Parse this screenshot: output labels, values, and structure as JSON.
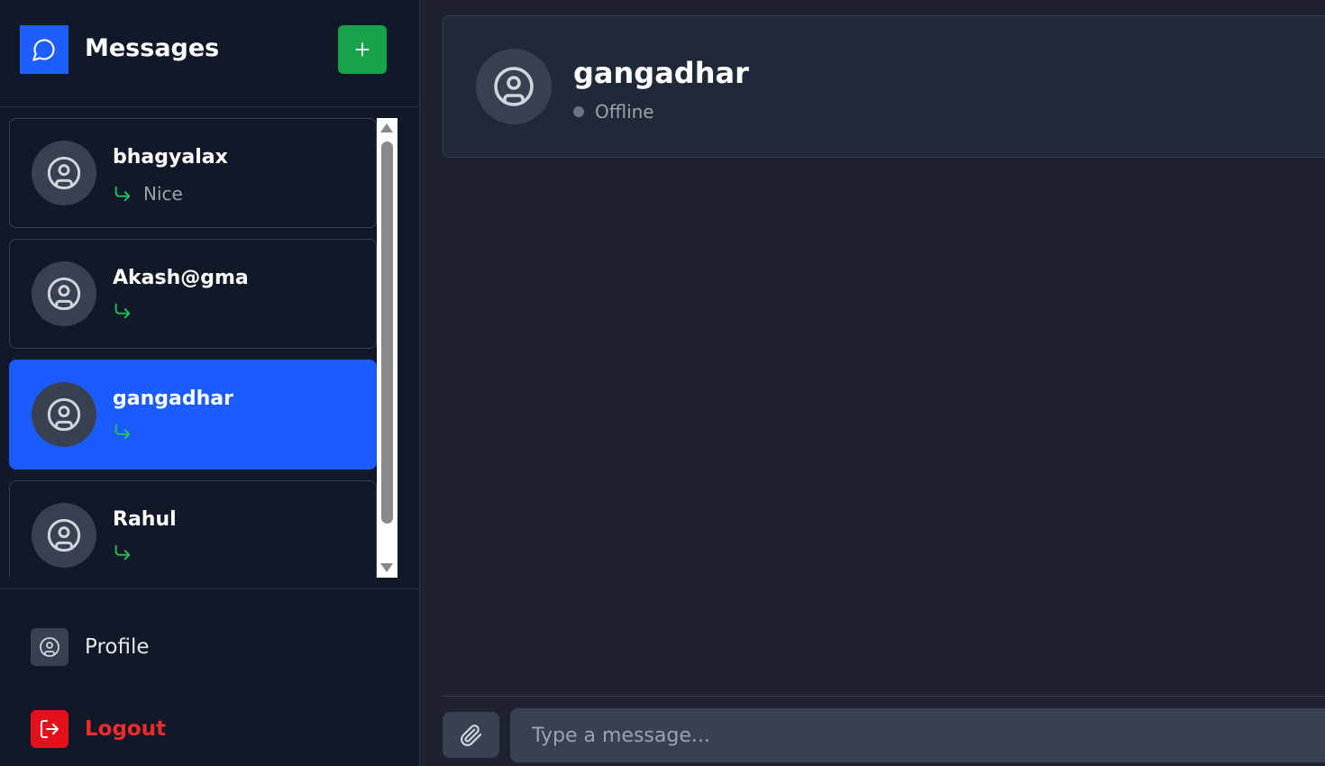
{
  "sidebar": {
    "title": "Messages",
    "new_button_icon": "plus-icon",
    "conversations": [
      {
        "name": "bhagyalax",
        "preview": "Nice",
        "active": false
      },
      {
        "name": "Akash@gma",
        "preview": "",
        "active": false
      },
      {
        "name": "gangadhar",
        "preview": "",
        "active": true
      },
      {
        "name": "Rahul",
        "preview": "",
        "active": false
      }
    ],
    "footer": {
      "profile_label": "Profile",
      "logout_label": "Logout"
    }
  },
  "chat": {
    "contact_name": "gangadhar",
    "status": "Offline"
  },
  "composer": {
    "placeholder": "Type a message..."
  },
  "colors": {
    "brand": "#1e5eff",
    "new_button": "#16a34a",
    "active_conversation": "#1a5cff",
    "reply_arrow": "#22c55e",
    "logout": "#e5101c"
  }
}
